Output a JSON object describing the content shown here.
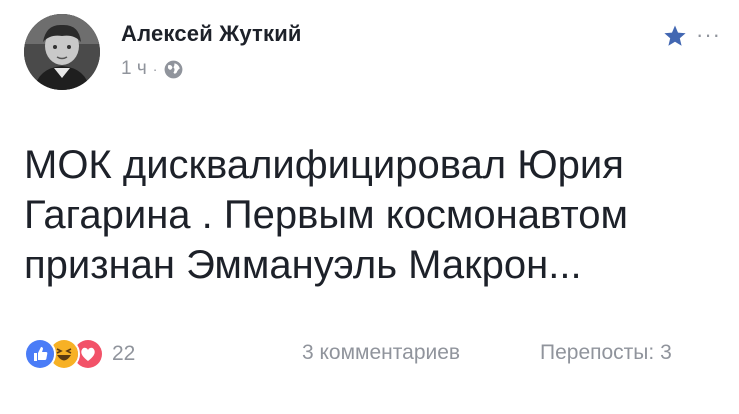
{
  "post": {
    "author": "Алексей Жуткий",
    "time": "1 ч",
    "separator": "·",
    "text_lines": [
      "МОК дисквалифицировал Юрия",
      "Гагарина . Первым космонавтом",
      "признан Эммануэль Макрон..."
    ],
    "more_label": "···"
  },
  "footer": {
    "reactions": [
      "like-icon",
      "haha-icon",
      "love-icon"
    ],
    "reaction_count": "22",
    "comments": "3 комментариев",
    "shares": "Перепосты: 3"
  },
  "colors": {
    "text": "#1d2129",
    "muted": "#90949c",
    "accent": "#4267b2",
    "love": "#f25268",
    "haha": "#f7b125"
  }
}
